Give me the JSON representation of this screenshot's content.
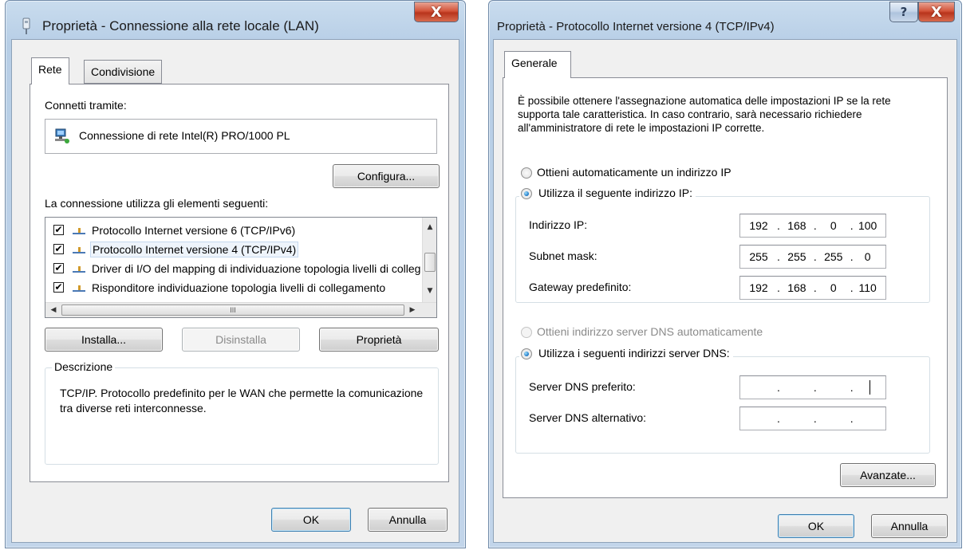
{
  "left_dialog": {
    "title": "Proprietà - Connessione alla rete locale (LAN)",
    "close_glyph": "X",
    "tabs": [
      "Rete",
      "Condivisione"
    ],
    "connect_using_label": "Connetti tramite:",
    "adapter_name": "Connessione di rete Intel(R) PRO/1000 PL",
    "configure_label": "Configura...",
    "items_label": "La connessione utilizza gli elementi seguenti:",
    "items": [
      {
        "label": "Protocollo Internet versione 6 (TCP/IPv6)",
        "checked": true
      },
      {
        "label": "Protocollo Internet versione 4 (TCP/IPv4)",
        "checked": true
      },
      {
        "label": "Driver di I/O del mapping di individuazione topologia livelli di collegamento",
        "checked": true
      },
      {
        "label": "Risponditore individuazione topologia livelli di collegamento",
        "checked": true
      }
    ],
    "check_glyph": "✔",
    "install_label": "Installa...",
    "uninstall_label": "Disinstalla",
    "properties_label": "Proprietà",
    "description_title": "Descrizione",
    "description_text": "TCP/IP. Protocollo predefinito per le WAN che permette la comunicazione tra diverse reti interconnesse.",
    "ok_label": "OK",
    "cancel_label": "Annulla",
    "hscroll_grip": "III"
  },
  "right_dialog": {
    "title": "Proprietà - Protocollo Internet versione 4 (TCP/IPv4)",
    "help_glyph": "?",
    "close_glyph": "X",
    "tabs": [
      "Generale"
    ],
    "intro_text": "È possibile ottenere l'assegnazione automatica delle impostazioni IP se la rete supporta tale caratteristica. In caso contrario, sarà necessario richiedere all'amministratore di rete le impostazioni IP corrette.",
    "auto_ip_label": "Ottieni automaticamente un indirizzo IP",
    "manual_ip_label": "Utilizza il seguente indirizzo IP:",
    "ip_address_label": "Indirizzo IP:",
    "ip_address": [
      "192",
      "168",
      "0",
      "100"
    ],
    "subnet_label": "Subnet mask:",
    "subnet": [
      "255",
      "255",
      "255",
      "0"
    ],
    "gateway_label": "Gateway predefinito:",
    "gateway": [
      "192",
      "168",
      "0",
      "110"
    ],
    "auto_dns_label": "Ottieni indirizzo server DNS automaticamente",
    "manual_dns_label": "Utilizza i seguenti indirizzi server DNS:",
    "preferred_dns_label": "Server DNS preferito:",
    "preferred_dns": [
      "",
      "",
      "",
      ""
    ],
    "alternate_dns_label": "Server DNS alternativo:",
    "alternate_dns": [
      "",
      "",
      "",
      ""
    ],
    "ip_separator": ".",
    "advanced_label": "Avanzate...",
    "ok_label": "OK",
    "cancel_label": "Annulla"
  }
}
